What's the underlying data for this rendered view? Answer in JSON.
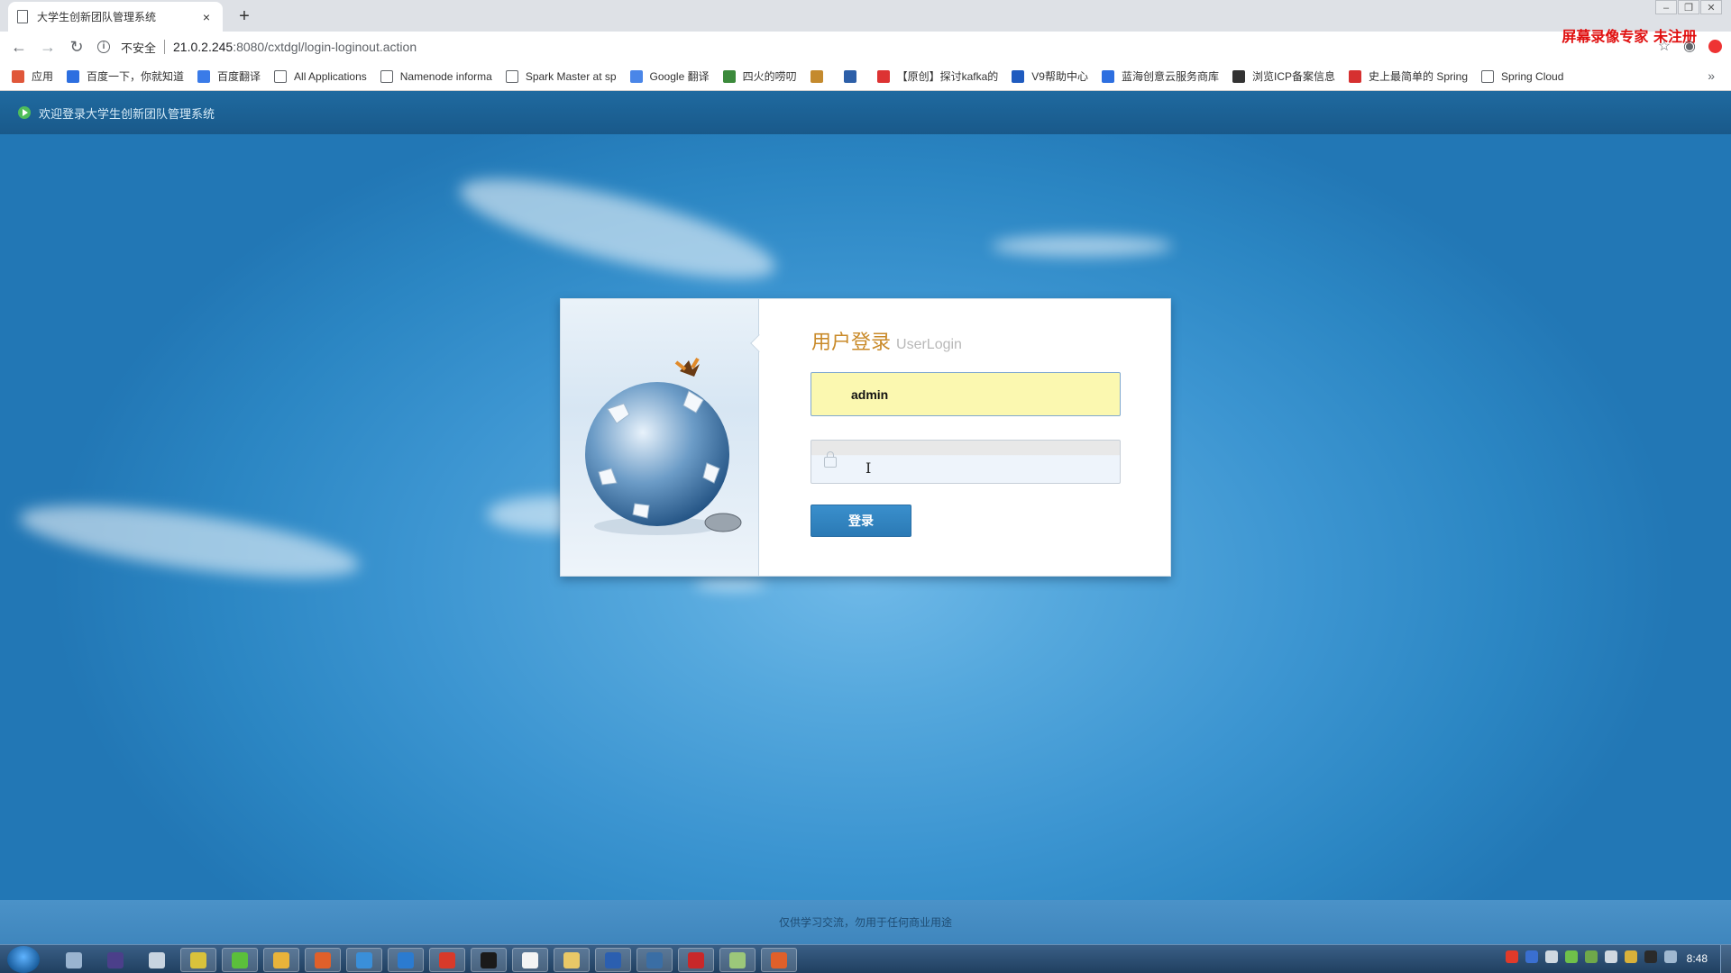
{
  "browser": {
    "tab_title": "大学生创新团队管理系统",
    "tab_close": "×",
    "new_tab": "+",
    "window_controls": [
      "–",
      "❐",
      "✕"
    ],
    "security_label": "不安全",
    "url_host": "21.0.2.245",
    "url_path": ":8080/cxtdgl/login-loginout.action",
    "bookmarks": [
      {
        "label": "应用",
        "icon": "apps-grid-icon",
        "color": "#e0573a"
      },
      {
        "label": "百度一下，你就知道",
        "icon": "baidu-paw-icon",
        "color": "#2d6fe0"
      },
      {
        "label": "百度翻译",
        "icon": "baidu-translate-icon",
        "color": "#3a7be8"
      },
      {
        "label": "All Applications",
        "icon": "page-icon",
        "color": "#ffffff"
      },
      {
        "label": "Namenode informa",
        "icon": "page-icon",
        "color": "#ffffff"
      },
      {
        "label": "Spark Master at sp",
        "icon": "page-icon",
        "color": "#ffffff"
      },
      {
        "label": "Google 翻译",
        "icon": "google-translate-icon",
        "color": "#4a86e8"
      },
      {
        "label": "四火的唠叨",
        "icon": "sihuo-icon",
        "color": "#3b8a3b"
      },
      {
        "label": "",
        "icon": "chart-bookmark-icon",
        "color": "#c48a2e"
      },
      {
        "label": "",
        "icon": "refresh-bookmark-icon",
        "color": "#2d5fa8"
      },
      {
        "label": "【原创】探讨kafka的",
        "icon": "csdn-icon",
        "color": "#d33"
      },
      {
        "label": "V9帮助中心",
        "icon": "pc-icon",
        "color": "#1f5bbf"
      },
      {
        "label": "蓝海创意云服务商库",
        "icon": "lanhai-icon",
        "color": "#2d6fe0"
      },
      {
        "label": "浏览ICP备案信息",
        "icon": "icp-icon",
        "color": "#333333"
      },
      {
        "label": "史上最简单的 Spring",
        "icon": "csdn-c-icon",
        "color": "#d63030"
      },
      {
        "label": "Spring Cloud",
        "icon": "page-icon",
        "color": "#ffffff"
      }
    ],
    "bookmarks_more": "»"
  },
  "watermark": "屏幕录像专家  未注册",
  "page": {
    "welcome": "欢迎登录大学生创新团队管理系统",
    "login": {
      "title_cn": "用户登录",
      "title_en": "UserLogin",
      "username_value": "admin",
      "password_value": "",
      "submit_label": "登录"
    },
    "footer_text": "仅供学习交流，勿用于任何商业用途"
  },
  "taskbar": {
    "clock": "8:48",
    "apps": [
      {
        "icon": "file-manager-icon",
        "color": "#9ab4d0"
      },
      {
        "icon": "eclipse-icon",
        "color": "#4b3f8a"
      },
      {
        "icon": "search-tool-icon",
        "color": "#c8d4e0"
      },
      {
        "icon": "spyglass-icon",
        "color": "#d9c23b"
      },
      {
        "icon": "refresh-green-icon",
        "color": "#5bbf3b"
      },
      {
        "icon": "chrome-icon",
        "color": "#e9b33a"
      },
      {
        "icon": "firefox-icon",
        "color": "#e0602a"
      },
      {
        "icon": "chat-icon",
        "color": "#3a8fd9"
      },
      {
        "icon": "window-app-icon",
        "color": "#2b7bd0"
      },
      {
        "icon": "red-app-icon",
        "color": "#d83a2a"
      },
      {
        "icon": "cmd-icon",
        "color": "#1a1a1a"
      },
      {
        "icon": "blank-doc-icon",
        "color": "#f4f4f4"
      },
      {
        "icon": "folder-icon",
        "color": "#e9c867"
      },
      {
        "icon": "word-icon",
        "color": "#2b5fb0"
      },
      {
        "icon": "feather-icon",
        "color": "#3a6ea5"
      },
      {
        "icon": "pdf-icon",
        "color": "#c8282a"
      },
      {
        "icon": "notepad-icon",
        "color": "#9cc77a"
      },
      {
        "icon": "recorder-icon",
        "color": "#e0602a"
      }
    ],
    "tray": [
      {
        "icon": "sogou-icon",
        "color": "#e03a2a"
      },
      {
        "icon": "help-icon",
        "color": "#3a6fd0"
      },
      {
        "icon": "pin-icon",
        "color": "#cfd8e0"
      },
      {
        "icon": "battery-icon",
        "color": "#6fc04a"
      },
      {
        "icon": "network-icon",
        "color": "#6fa84a"
      },
      {
        "icon": "volume-icon",
        "color": "#d0d8e0"
      },
      {
        "icon": "security-icon",
        "color": "#d9b13a"
      },
      {
        "icon": "qq-icon",
        "color": "#2a2a2a"
      },
      {
        "icon": "display-icon",
        "color": "#a0b8d0"
      }
    ]
  }
}
